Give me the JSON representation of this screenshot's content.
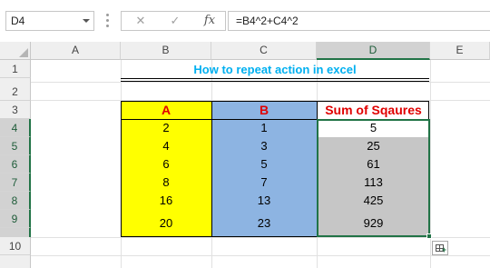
{
  "formula_bar": {
    "name_box": "D4",
    "cancel_glyph": "✕",
    "enter_glyph": "✓",
    "fx_label": "fx",
    "formula": "=B4^2+C4^2"
  },
  "columns": [
    "A",
    "B",
    "C",
    "D",
    "E"
  ],
  "rows": [
    "1",
    "2",
    "3",
    "4",
    "5",
    "6",
    "7",
    "8",
    "9",
    "10"
  ],
  "selected": {
    "column": "D",
    "rows": [
      "4",
      "5",
      "6",
      "7",
      "8",
      "9"
    ]
  },
  "sheet": {
    "title": "How to repeat action in excel",
    "headers": {
      "a": "A",
      "b": "B",
      "sum": "Sum of Sqaures"
    },
    "data": [
      {
        "a": "2",
        "b": "1",
        "sum": "5"
      },
      {
        "a": "4",
        "b": "3",
        "sum": "25"
      },
      {
        "a": "6",
        "b": "5",
        "sum": "61"
      },
      {
        "a": "8",
        "b": "7",
        "sum": "113"
      },
      {
        "a": "16",
        "b": "13",
        "sum": "425"
      },
      {
        "a": "20",
        "b": "23",
        "sum": "929"
      }
    ]
  },
  "colors": {
    "col_a_fill": "#ffff00",
    "col_b_fill": "#8db4e2",
    "sum_fill": "#c6c6c6",
    "header_text": "#e00000",
    "title_text": "#00b0f0",
    "selection": "#217346"
  },
  "icons": {
    "namebox_dropdown": "chevron-down-icon",
    "cancel": "close-icon",
    "enter": "check-icon",
    "function": "fx-icon",
    "quick_analysis": "quick-analysis-icon",
    "select_all": "select-all-triangle-icon"
  }
}
